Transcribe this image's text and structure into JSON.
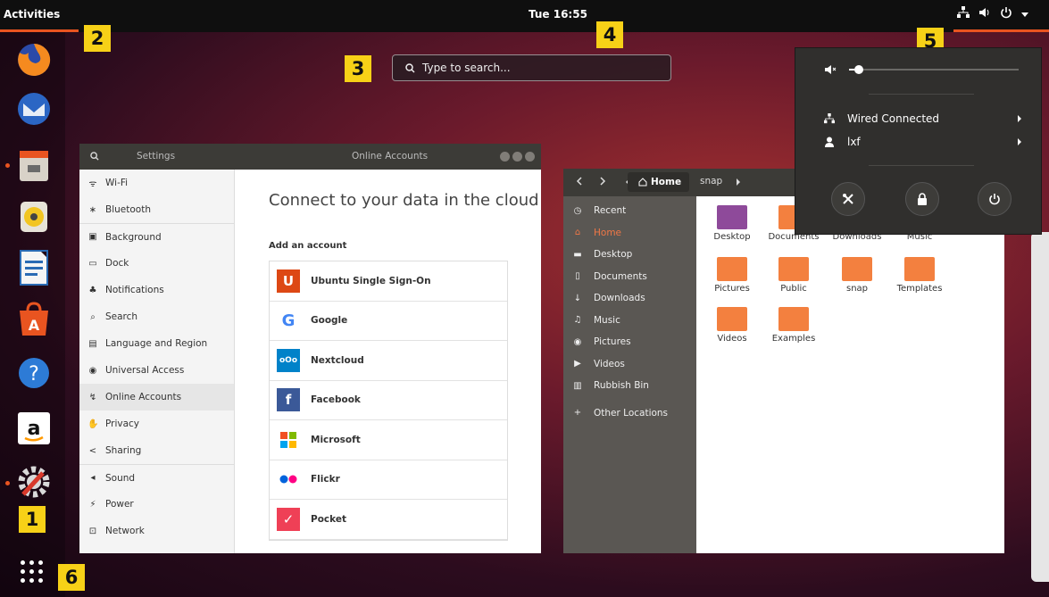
{
  "topbar": {
    "activities": "Activities",
    "clock": "Tue 16:55",
    "tray_icons": [
      "network-icon",
      "volume-icon",
      "power-icon",
      "dropdown-arrow-icon"
    ]
  },
  "markers": [
    "1",
    "2",
    "3",
    "4",
    "5",
    "6"
  ],
  "search": {
    "placeholder": "Type to search..."
  },
  "dock": {
    "apps": [
      "Firefox",
      "Thunderbird",
      "Files",
      "Rhythmbox",
      "LibreOffice Writer",
      "Ubuntu Software",
      "Help",
      "Amazon",
      "Settings"
    ],
    "running": [
      "Files",
      "Settings"
    ]
  },
  "settings": {
    "header_search_icon": "search-icon",
    "header_left_title": "Settings",
    "header_title": "Online Accounts",
    "sidebar": [
      {
        "label": "Wi-Fi",
        "icon": "wifi-icon"
      },
      {
        "label": "Bluetooth",
        "icon": "bluetooth-icon"
      },
      {
        "label": "Background",
        "icon": "background-icon"
      },
      {
        "label": "Dock",
        "icon": "dock-icon"
      },
      {
        "label": "Notifications",
        "icon": "bell-icon"
      },
      {
        "label": "Search",
        "icon": "search-icon"
      },
      {
        "label": "Language and Region",
        "icon": "language-icon"
      },
      {
        "label": "Universal Access",
        "icon": "accessibility-icon"
      },
      {
        "label": "Online Accounts",
        "icon": "online-accounts-icon",
        "active": true
      },
      {
        "label": "Privacy",
        "icon": "privacy-icon"
      },
      {
        "label": "Sharing",
        "icon": "share-icon"
      },
      {
        "label": "Sound",
        "icon": "sound-icon"
      },
      {
        "label": "Power",
        "icon": "power-icon"
      },
      {
        "label": "Network",
        "icon": "network-icon"
      }
    ],
    "main": {
      "heading": "Connect to your data in the cloud",
      "subheading": "Add an account",
      "accounts": [
        {
          "name": "Ubuntu Single Sign-On",
          "logo": "U",
          "color": "#dd4814"
        },
        {
          "name": "Google",
          "logo": "G",
          "color": "#4285f4"
        },
        {
          "name": "Nextcloud",
          "logo": "oOo",
          "color": "#0082c9"
        },
        {
          "name": "Facebook",
          "logo": "f",
          "color": "#3b5998"
        },
        {
          "name": "Microsoft",
          "logo": "ms",
          "color": "#f25022"
        },
        {
          "name": "Flickr",
          "logo": "●●",
          "color": "#0063dc"
        },
        {
          "name": "Pocket",
          "logo": "✓",
          "color": "#ef4056"
        }
      ]
    }
  },
  "files": {
    "path": [
      "Home",
      "snap"
    ],
    "sidebar": [
      {
        "label": "Recent",
        "icon": "clock-icon"
      },
      {
        "label": "Home",
        "icon": "home-icon",
        "active": true
      },
      {
        "label": "Desktop",
        "icon": "folder-icon"
      },
      {
        "label": "Documents",
        "icon": "document-icon"
      },
      {
        "label": "Downloads",
        "icon": "download-icon"
      },
      {
        "label": "Music",
        "icon": "music-icon"
      },
      {
        "label": "Pictures",
        "icon": "camera-icon"
      },
      {
        "label": "Videos",
        "icon": "video-icon"
      },
      {
        "label": "Rubbish Bin",
        "icon": "trash-icon"
      },
      {
        "label": "Other Locations",
        "icon": "plus-icon"
      }
    ],
    "folders": [
      {
        "name": "Desktop",
        "color": "#8e4a9a"
      },
      {
        "name": "Documents",
        "color": "#f3803f"
      },
      {
        "name": "Downloads",
        "color": "#f3803f"
      },
      {
        "name": "Music",
        "color": "#f3803f"
      },
      {
        "name": "Pictures",
        "color": "#f3803f"
      },
      {
        "name": "Public",
        "color": "#f3803f"
      },
      {
        "name": "snap",
        "color": "#f3803f"
      },
      {
        "name": "Templates",
        "color": "#f3803f"
      },
      {
        "name": "Videos",
        "color": "#f3803f"
      },
      {
        "name": "Examples",
        "color": "#f3803f"
      }
    ]
  },
  "system_menu": {
    "volume_level": 0.03,
    "items": [
      {
        "label": "Wired Connected",
        "icon": "network-icon"
      },
      {
        "label": "lxf",
        "icon": "user-icon"
      }
    ],
    "buttons": [
      "settings-icon",
      "lock-icon",
      "power-icon"
    ]
  }
}
